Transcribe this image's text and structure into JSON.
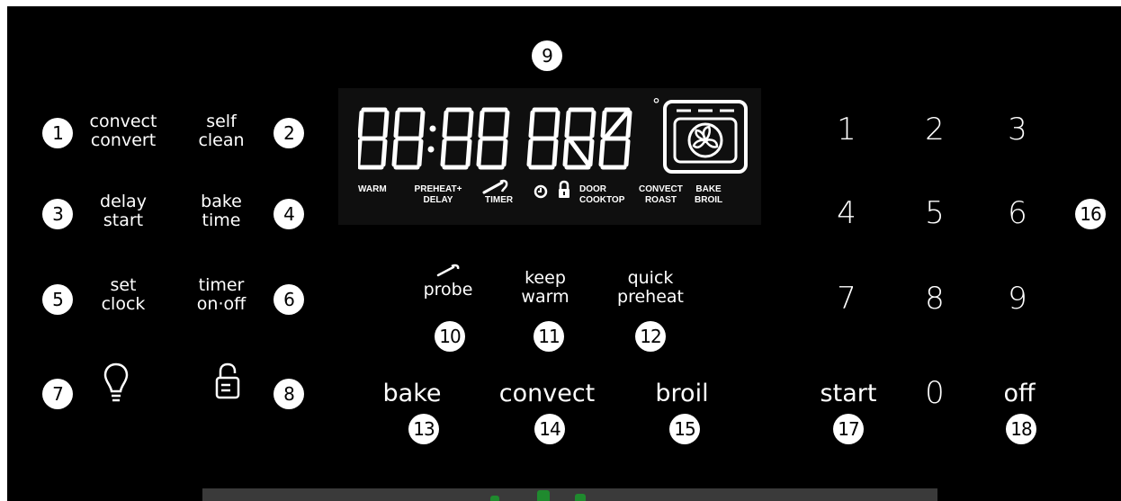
{
  "left_keys": {
    "convect_convert": {
      "badge": "1",
      "line1": "convect",
      "line2": "convert"
    },
    "self_clean": {
      "badge": "2",
      "line1": "self",
      "line2": "clean"
    },
    "delay_start": {
      "badge": "3",
      "line1": "delay",
      "line2": "start"
    },
    "bake_time": {
      "badge": "4",
      "line1": "bake",
      "line2": "time"
    },
    "set_clock": {
      "badge": "5",
      "line1": "set",
      "line2": "clock"
    },
    "timer_onoff": {
      "badge": "6",
      "line1": "timer",
      "line2": "on·off"
    },
    "light": {
      "badge": "7",
      "icon": "light-bulb-icon"
    },
    "lock": {
      "badge": "8",
      "icon": "lock-icon"
    }
  },
  "display": {
    "badge": "9",
    "digits": "88:88 888",
    "degree": "°",
    "indicators": {
      "warm": "WARM",
      "preheat_line1": "PREHEAT+",
      "preheat_line2": "DELAY",
      "timer": "TIMER",
      "door_line1": "DOOR",
      "door_line2": "COOKTOP",
      "convect_line1": "CONVECT",
      "convect_line2": "ROAST",
      "bake_line1": "BAKE",
      "bake_line2": "BROIL"
    },
    "icons": [
      "clock-icon",
      "lock-icon",
      "probe-icon",
      "oven-fan-icon"
    ]
  },
  "middle_keys": {
    "probe": {
      "badge": "10",
      "label": "probe",
      "icon": "probe-icon"
    },
    "keep_warm": {
      "badge": "11",
      "line1": "keep",
      "line2": "warm"
    },
    "quick_preheat": {
      "badge": "12",
      "line1": "quick",
      "line2": "preheat"
    },
    "bake": {
      "badge": "13",
      "label": "bake"
    },
    "convect": {
      "badge": "14",
      "label": "convect"
    },
    "broil": {
      "badge": "15",
      "label": "broil"
    }
  },
  "keypad": {
    "badge": "16",
    "digits": [
      "1",
      "2",
      "3",
      "4",
      "5",
      "6",
      "7",
      "8",
      "9",
      "0"
    ],
    "start": {
      "badge": "17",
      "label": "start"
    },
    "off": {
      "badge": "18",
      "label": "off"
    }
  }
}
